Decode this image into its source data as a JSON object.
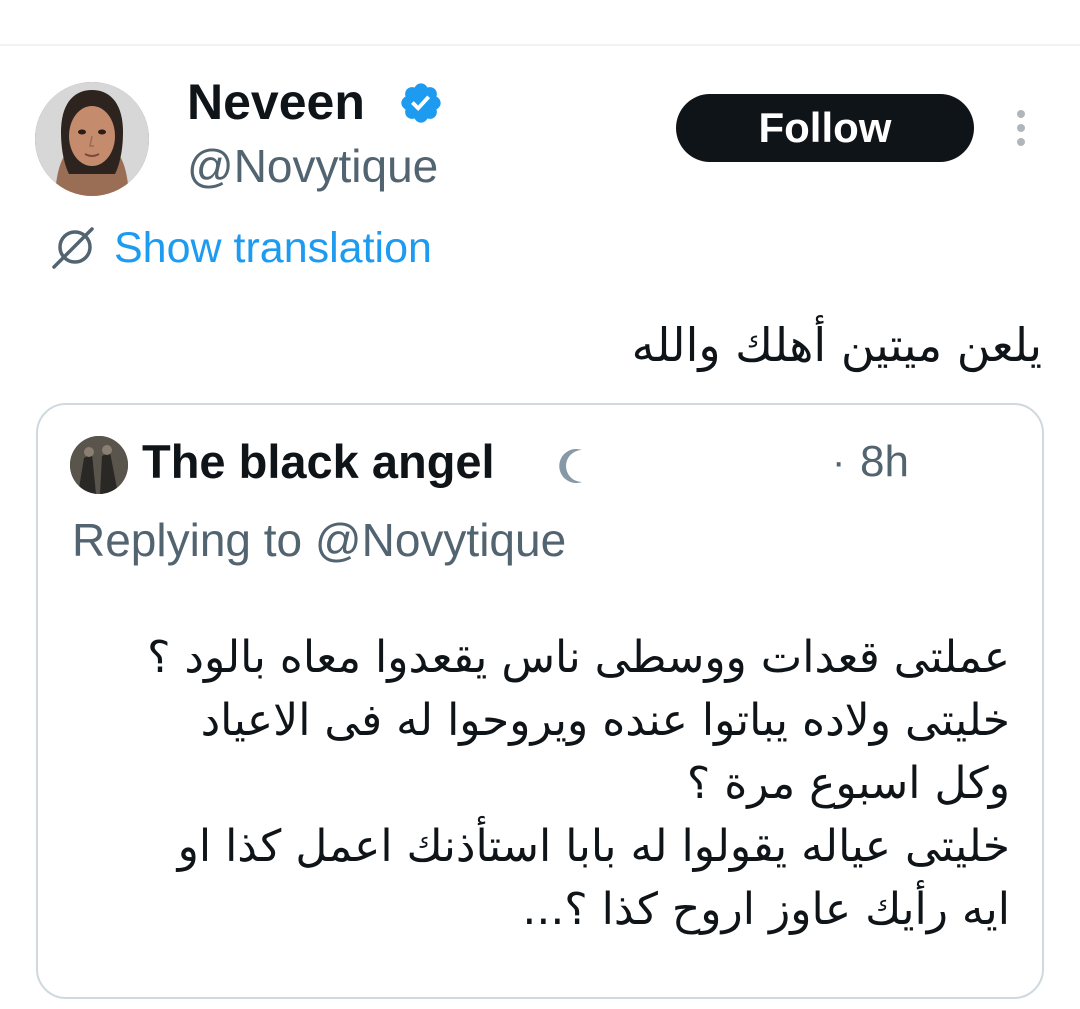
{
  "author": {
    "name": "Neveen",
    "handle": "@Novytique",
    "verified": true,
    "verified_color": "#1d9bf0"
  },
  "actions": {
    "follow_label": "Follow",
    "more_icon": "vertical-dots-icon"
  },
  "translation": {
    "label": "Show translation",
    "icon": "translate-globe-icon"
  },
  "tweet": {
    "text": "يلعن ميتين أهلك والله"
  },
  "quoted_tweet": {
    "author_name": "The black angel",
    "badge_icon": "crescent-moon-icon",
    "separator": "·",
    "time": "8h",
    "replying_to": "Replying to @Novytique",
    "lines": [
      "عملتى قعدات ووسطى ناس يقعدوا معاه بالود ؟",
      "خليتى ولاده يباتوا عنده ويروحوا له فى الاعياد",
      "وكل اسبوع مرة ؟",
      "خليتى عياله يقولوا له بابا استأذنك اعمل كذا او",
      "ايه رأيك عاوز اروح كذا ؟..."
    ]
  },
  "colors": {
    "text_primary": "#0f1419",
    "text_secondary": "#536471",
    "link": "#1d9bf0",
    "border": "#cfd9de"
  }
}
